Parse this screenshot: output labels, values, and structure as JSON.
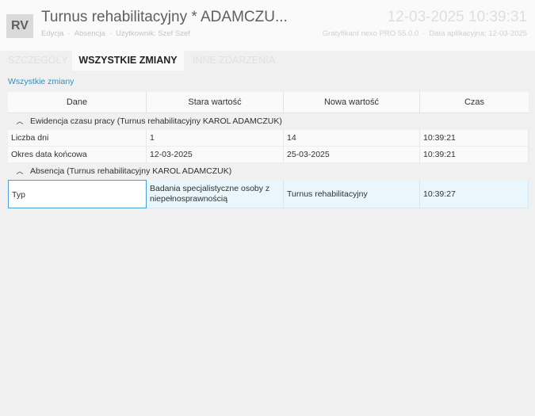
{
  "header": {
    "badge": "RV",
    "title": "Turnus rehabilitacyjny * ADAMCZU...",
    "datetime": "12-03-2025 10:39:31",
    "sub_left": [
      "Edycja",
      "Absencja",
      "Użytkownik: Szef Szef"
    ],
    "sub_right": [
      "Gratyfikant nexo PRO 55.0.0",
      "Data aplikacyjna: 12-03-2025"
    ]
  },
  "tabs": [
    {
      "label": "SZCZEGÓŁY",
      "active": false
    },
    {
      "label": "WSZYSTKIE ZMIANY",
      "active": true
    },
    {
      "label": "INNE ZDARZENIA",
      "active": false
    }
  ],
  "section": {
    "link": "Wszystkie zmiany"
  },
  "grid": {
    "columns": [
      "Dane",
      "Stara wartość",
      "Nowa wartość",
      "Czas"
    ],
    "groups": [
      {
        "label": "Ewidencja czasu pracy (Turnus rehabilitacyjny KAROL ADAMCZUK)",
        "rows": [
          {
            "dane": "Liczba dni",
            "stara": "1",
            "nowa": "14",
            "czas": "10:39:21"
          },
          {
            "dane": "Okres data końcowa",
            "stara": "12-03-2025",
            "nowa": "25-03-2025",
            "czas": "10:39:21"
          }
        ]
      },
      {
        "label": "Absencja (Turnus rehabilitacyjny KAROL ADAMCZUK)",
        "rows": [
          {
            "dane": "Typ",
            "stara": "Badania specjalistyczne osoby z niepełnosprawnością",
            "nowa": "Turnus rehabilitacyjny",
            "czas": "10:39:27"
          }
        ]
      }
    ]
  },
  "colors": {
    "accent": "#2f8fc4",
    "selected_row": "#e9f6fc",
    "focus_border": "#4a9fd3"
  }
}
